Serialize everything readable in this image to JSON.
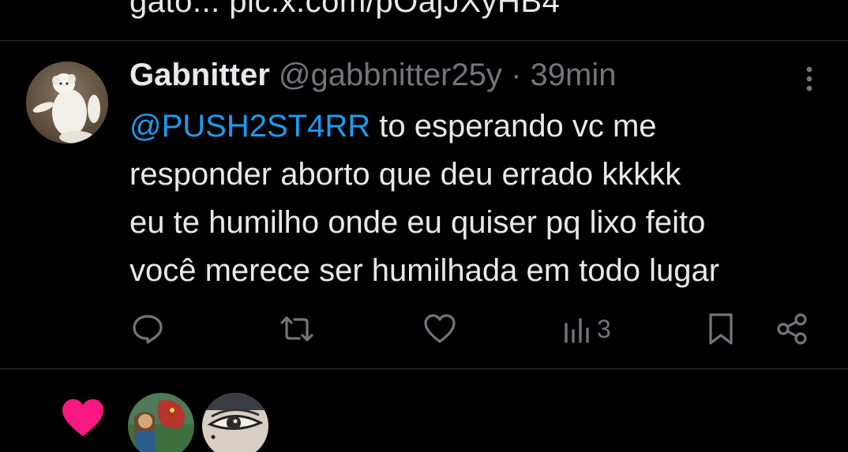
{
  "previous_tweet": {
    "text_fragment": "gato... pic.x.com/pOajJXyHB4"
  },
  "tweet": {
    "author_name": "Gabnitter",
    "handle": "@gabbnitter25y",
    "separator": "·",
    "time": "39min",
    "mention": "@PUSH2ST4RR",
    "lines": [
      " to esperando vc me",
      "responder aborto que deu errado kkkkk",
      "eu te humilho onde eu quiser pq lixo feito",
      "você merece ser humilhada em todo lugar"
    ],
    "views_count": "3",
    "icons": {
      "more": "more-vertical-icon",
      "reply": "reply-icon",
      "retweet": "retweet-icon",
      "like": "heart-icon",
      "views": "views-icon",
      "bookmark": "bookmark-icon",
      "share": "share-icon"
    }
  },
  "footer": {
    "icon": "liked-heart-icon",
    "accent_color": "#f91880"
  },
  "colors": {
    "background": "#000000",
    "text": "#e7e9ea",
    "secondary": "#71767b",
    "link": "#1d9bf0",
    "divider": "#2f3336"
  }
}
